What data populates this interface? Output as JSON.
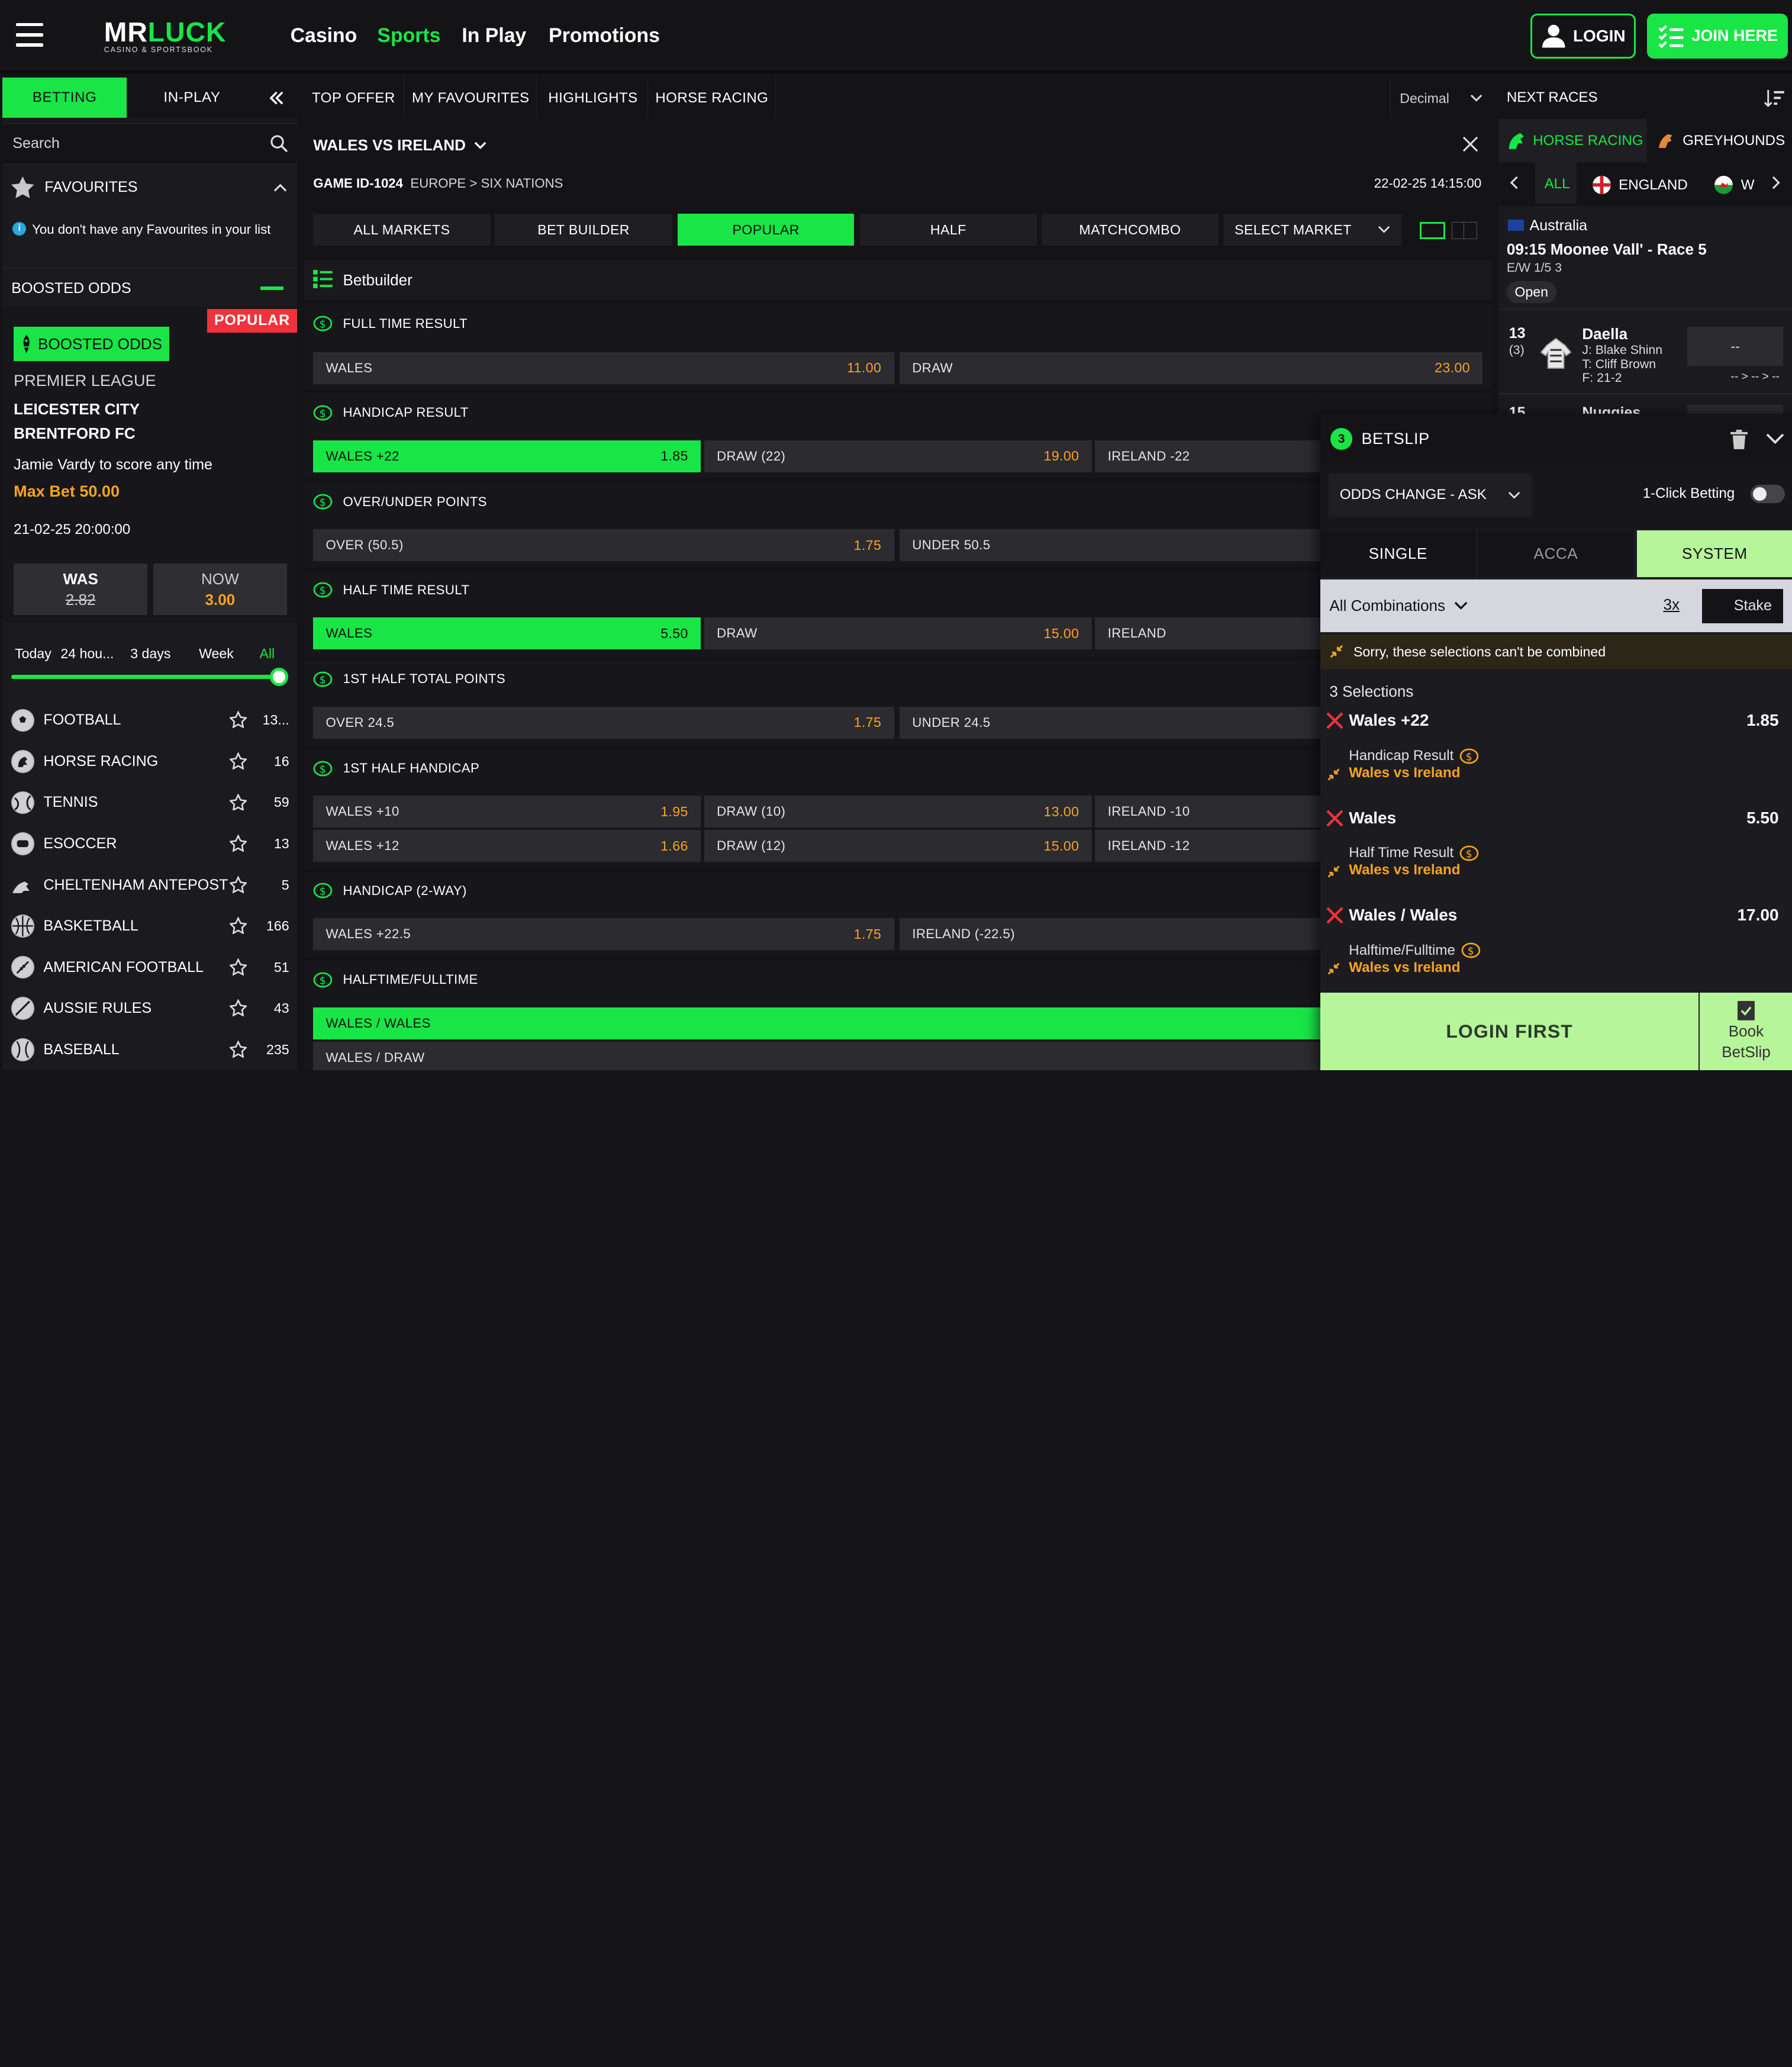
{
  "header": {
    "logo_main": "MR",
    "logo_accent": "LUCK",
    "logo_sub": "CASINO & SPORTSBOOK",
    "nav": [
      {
        "label": "Casino",
        "active": false
      },
      {
        "label": "Sports",
        "active": true
      },
      {
        "label": "In Play",
        "active": false
      },
      {
        "label": "Promotions",
        "active": false
      }
    ],
    "login_label": "LOGIN",
    "join_label": "JOIN HERE"
  },
  "colors": {
    "accent": "#19e547",
    "price": "#f8a31f",
    "popular": "#f0323c",
    "background": "#141417"
  },
  "left": {
    "tabs": {
      "betting": "BETTING",
      "inplay": "IN-PLAY"
    },
    "search_placeholder": "Search",
    "favourites_label": "FAVOURITES",
    "favourites_empty": "You don't have any Favourites in your list",
    "boosted_odds_header": "BOOSTED ODDS",
    "popular_tag": "POPULAR",
    "boost": {
      "button": "BOOSTED ODDS",
      "league": "PREMIER LEAGUE",
      "team1": "LEICESTER CITY",
      "team2": "BRENTFORD FC",
      "market": "Jamie Vardy to score any time",
      "max_bet": "Max Bet 50.00",
      "datetime": "21-02-25 20:00:00",
      "was_label": "WAS",
      "was_value": "2.82",
      "now_label": "NOW",
      "now_value": "3.00"
    },
    "time_filters": [
      "Today",
      "24 hou...",
      "3 days",
      "Week",
      "All"
    ],
    "sports": [
      {
        "name": "FOOTBALL",
        "count": "13...",
        "icon": "football-icon"
      },
      {
        "name": "HORSE RACING",
        "count": "16",
        "icon": "horse-icon"
      },
      {
        "name": "TENNIS",
        "count": "59",
        "icon": "tennis-icon"
      },
      {
        "name": "ESOCCER",
        "count": "13",
        "icon": "esoccer-icon"
      },
      {
        "name": "CHELTENHAM ANTEPOST",
        "count": "5",
        "icon": "cheltenham-icon"
      },
      {
        "name": "BASKETBALL",
        "count": "166",
        "icon": "basketball-icon"
      },
      {
        "name": "AMERICAN FOOTBALL",
        "count": "51",
        "icon": "american-football-icon"
      },
      {
        "name": "AUSSIE RULES",
        "count": "43",
        "icon": "aussie-rules-icon"
      },
      {
        "name": "BASEBALL",
        "count": "235",
        "icon": "baseball-icon"
      }
    ]
  },
  "center": {
    "subtabs": [
      "TOP OFFER",
      "MY FAVOURITES",
      "HIGHLIGHTS",
      "HORSE RACING"
    ],
    "odds_format": "Decimal",
    "match_title": "WALES VS IRELAND",
    "game_id": "GAME ID-1024",
    "path": "EUROPE > SIX NATIONS",
    "datetime": "22-02-25 14:15:00",
    "market_tabs": [
      "ALL MARKETS",
      "BET BUILDER",
      "POPULAR",
      "HALF",
      "MATCHCOMBO"
    ],
    "select_market": "SELECT MARKET",
    "betbuilder_label": "Betbuilder",
    "sections": [
      {
        "title": "FULL TIME RESULT",
        "rows": [
          [
            {
              "label": "WALES",
              "price": "11.00"
            },
            {
              "label": "DRAW",
              "price": "23.00"
            }
          ]
        ]
      },
      {
        "title": "HANDICAP RESULT",
        "rows": [
          [
            {
              "label": "WALES +22",
              "price": "1.85",
              "selected": true
            },
            {
              "label": "DRAW (22)",
              "price": "19.00"
            },
            {
              "label": "IRELAND -22",
              "price": ""
            }
          ]
        ]
      },
      {
        "title": "OVER/UNDER POINTS",
        "rows": [
          [
            {
              "label": "OVER (50.5)",
              "price": "1.75"
            },
            {
              "label": "UNDER 50.5",
              "price": ""
            }
          ]
        ]
      },
      {
        "title": "HALF TIME RESULT",
        "rows": [
          [
            {
              "label": "WALES",
              "price": "5.50",
              "selected": true
            },
            {
              "label": "DRAW",
              "price": "15.00"
            },
            {
              "label": "IRELAND",
              "price": ""
            }
          ]
        ]
      },
      {
        "title": "1ST HALF TOTAL POINTS",
        "rows": [
          [
            {
              "label": "OVER 24.5",
              "price": "1.75"
            },
            {
              "label": "UNDER 24.5",
              "price": ""
            }
          ]
        ]
      },
      {
        "title": "1ST HALF HANDICAP",
        "rows": [
          [
            {
              "label": "WALES +10",
              "price": "1.95"
            },
            {
              "label": "DRAW (10)",
              "price": "13.00"
            },
            {
              "label": "IRELAND -10",
              "price": ""
            }
          ],
          [
            {
              "label": "WALES +12",
              "price": "1.66"
            },
            {
              "label": "DRAW (12)",
              "price": "15.00"
            },
            {
              "label": "IRELAND -12",
              "price": ""
            }
          ]
        ]
      },
      {
        "title": "HANDICAP (2-WAY)",
        "rows": [
          [
            {
              "label": "WALES +22.5",
              "price": "1.75"
            },
            {
              "label": "IRELAND (-22.5)",
              "price": ""
            }
          ]
        ]
      },
      {
        "title": "HALFTIME/FULLTIME",
        "rows": [
          [
            {
              "label": "WALES / WALES",
              "price": "",
              "selected": true
            }
          ],
          [
            {
              "label": "WALES / DRAW",
              "price": ""
            }
          ]
        ]
      }
    ]
  },
  "right": {
    "next_races_label": "NEXT RACES",
    "tabs": {
      "horse": "HORSE RACING",
      "grey": "GREYHOUNDS"
    },
    "countries": [
      "ALL",
      "ENGLAND",
      "W"
    ],
    "race": {
      "country": "Australia",
      "title": "09:15 Moonee Vall' - Race 5",
      "ew": "E/W 1/5 3",
      "status": "Open",
      "runner_no": "13",
      "runner_draw": "(3)",
      "runner_name": "Daella",
      "jockey": "J: Blake Shinn",
      "trainer": "T: Cliff Brown",
      "form": "F: 21-2",
      "price": "--",
      "trend": "-- > -- > --",
      "next_runner_no": "15",
      "next_runner_name": "Nuggies"
    }
  },
  "betslip": {
    "count": "3",
    "title": "BETSLIP",
    "odds_change": "ODDS CHANGE - ASK",
    "one_click": "1-Click Betting",
    "tabs": [
      "SINGLE",
      "ACCA",
      "SYSTEM"
    ],
    "combo_label": "All Combinations",
    "multiplier": "3x",
    "stake_placeholder": "Stake",
    "warning": "Sorry, these selections can't be combined",
    "selections_count": "3 Selections",
    "selections": [
      {
        "name": "Wales +22",
        "odds": "1.85",
        "market": "Handicap Result",
        "match": "Wales vs Ireland"
      },
      {
        "name": "Wales",
        "odds": "5.50",
        "market": "Half Time Result",
        "match": "Wales vs Ireland"
      },
      {
        "name": "Wales / Wales",
        "odds": "17.00",
        "market": "Halftime/Fulltime",
        "match": "Wales vs Ireland"
      }
    ],
    "login_first": "LOGIN FIRST",
    "book_label1": "Book",
    "book_label2": "BetSlip"
  }
}
